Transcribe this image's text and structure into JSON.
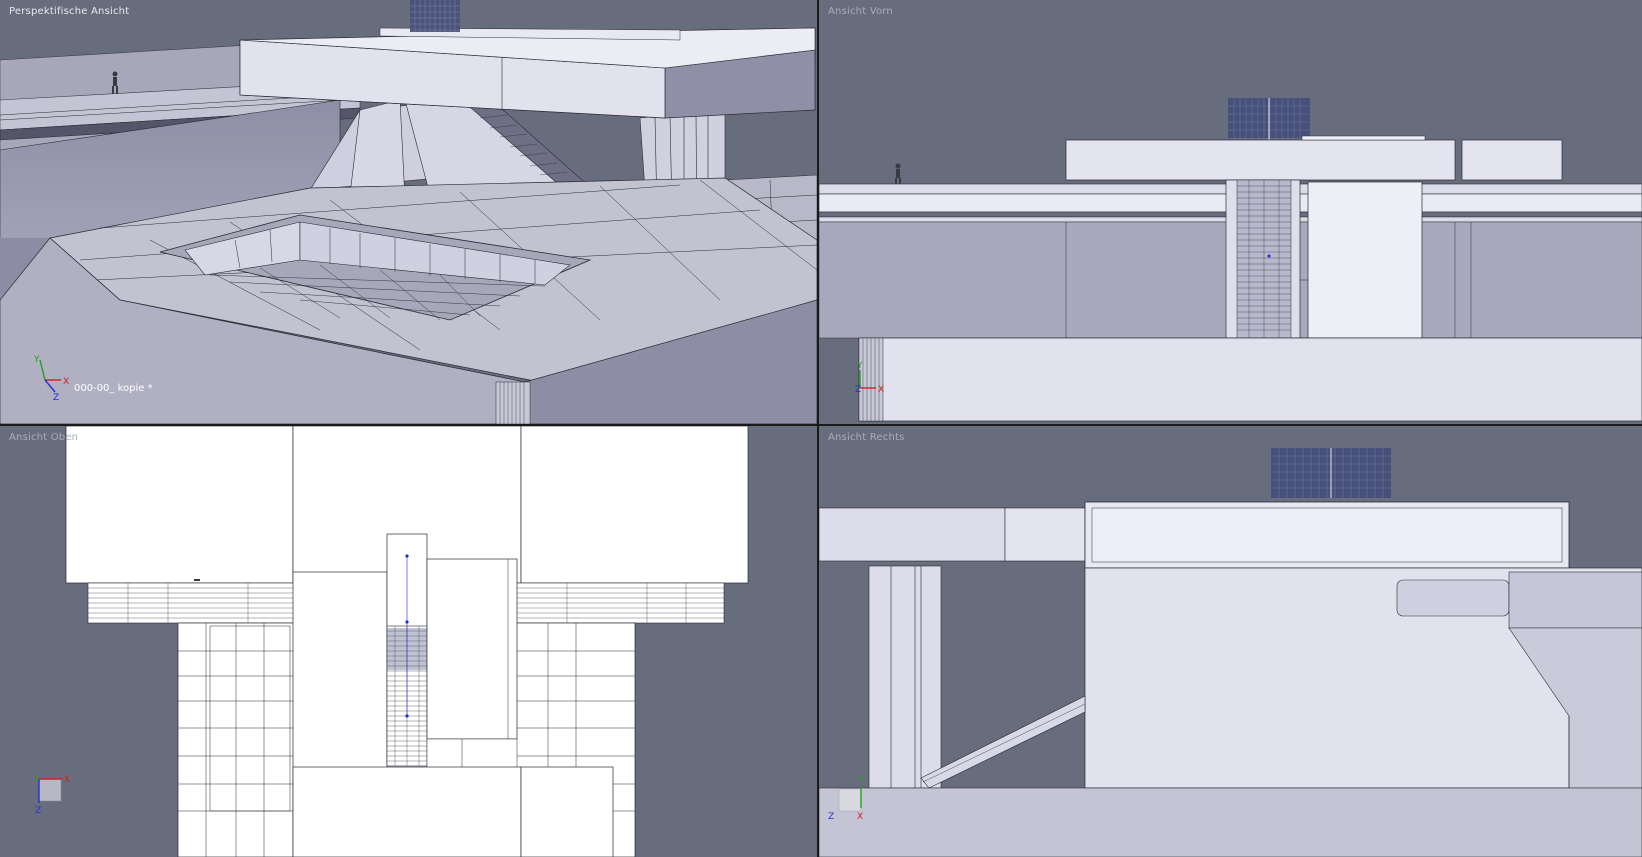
{
  "viewports": {
    "perspective": {
      "label": "Perspektifische Ansicht",
      "file_name": "000-00_ kopie *"
    },
    "front": {
      "label": "Ansicht Vorn"
    },
    "top": {
      "label": "Ansicht Oben"
    },
    "right": {
      "label": "Ansicht Rechts"
    }
  },
  "axes": {
    "x": "X",
    "y": "Y",
    "z": "Z"
  },
  "icons": {
    "axis_triad": "axis-triad-icon",
    "human_scale_figure": "human-figure-icon"
  },
  "colors": {
    "viewport_background": "#676d7d",
    "model_fill": "#dcdcec",
    "model_shadow": "#a6a6b9",
    "edge": "#2a2a33",
    "grid_block": "#47507a",
    "axis_x": "#d02020",
    "axis_y": "#20a020",
    "axis_z": "#2030d0"
  }
}
